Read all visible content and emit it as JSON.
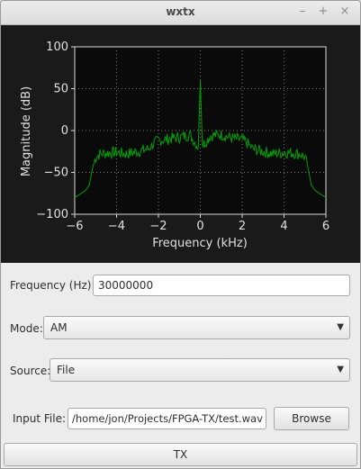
{
  "window": {
    "title": "wxtx",
    "controls": [
      "–",
      "+",
      "×"
    ]
  },
  "chart_data": {
    "type": "line",
    "title": "",
    "xlabel": "Frequency (kHz)",
    "ylabel": "Magnitude (dB)",
    "xlim": [
      -6,
      6
    ],
    "ylim": [
      -100,
      100
    ],
    "xticks": [
      "−6",
      "−4",
      "−2",
      "0",
      "2",
      "4",
      "6"
    ],
    "yticks": [
      "100",
      "50",
      "0",
      "−50",
      "−100"
    ],
    "grid": true,
    "line_color": "#00a000",
    "series": [
      {
        "x": [
          -6.0,
          -5.5,
          -5.3,
          -5.15,
          -5.0,
          -4.8,
          -4.5,
          -4.0,
          -3.5,
          -3.0,
          -2.5,
          -2.2,
          -2.0,
          -1.5,
          -1.0,
          -0.5,
          -0.1,
          0.0,
          0.1,
          0.5,
          1.0,
          1.5,
          2.0,
          2.2,
          2.5,
          3.0,
          3.5,
          4.0,
          4.5,
          4.8,
          5.0,
          5.15,
          5.3,
          5.5,
          6.0
        ],
        "y": [
          -80,
          -72,
          -65,
          -45,
          -32,
          -28,
          -27,
          -26,
          -28,
          -25,
          -22,
          -15,
          -12,
          -10,
          -8,
          -5,
          -20,
          60,
          -18,
          -6,
          -5,
          -9,
          -11,
          -14,
          -22,
          -25,
          -28,
          -26,
          -27,
          -28,
          -32,
          -45,
          -65,
          -72,
          -80
        ]
      }
    ]
  },
  "form": {
    "frequency": {
      "label": "Frequency (Hz):",
      "value": "30000000"
    },
    "mode": {
      "label": "Mode:",
      "value": "AM"
    },
    "source": {
      "label": "Source:",
      "value": "File"
    },
    "input_file": {
      "label": "Input File:",
      "value": "/home/jon/Projects/FPGA-TX/test.wav",
      "browse_label": "Browse"
    },
    "tx_label": "TX"
  }
}
